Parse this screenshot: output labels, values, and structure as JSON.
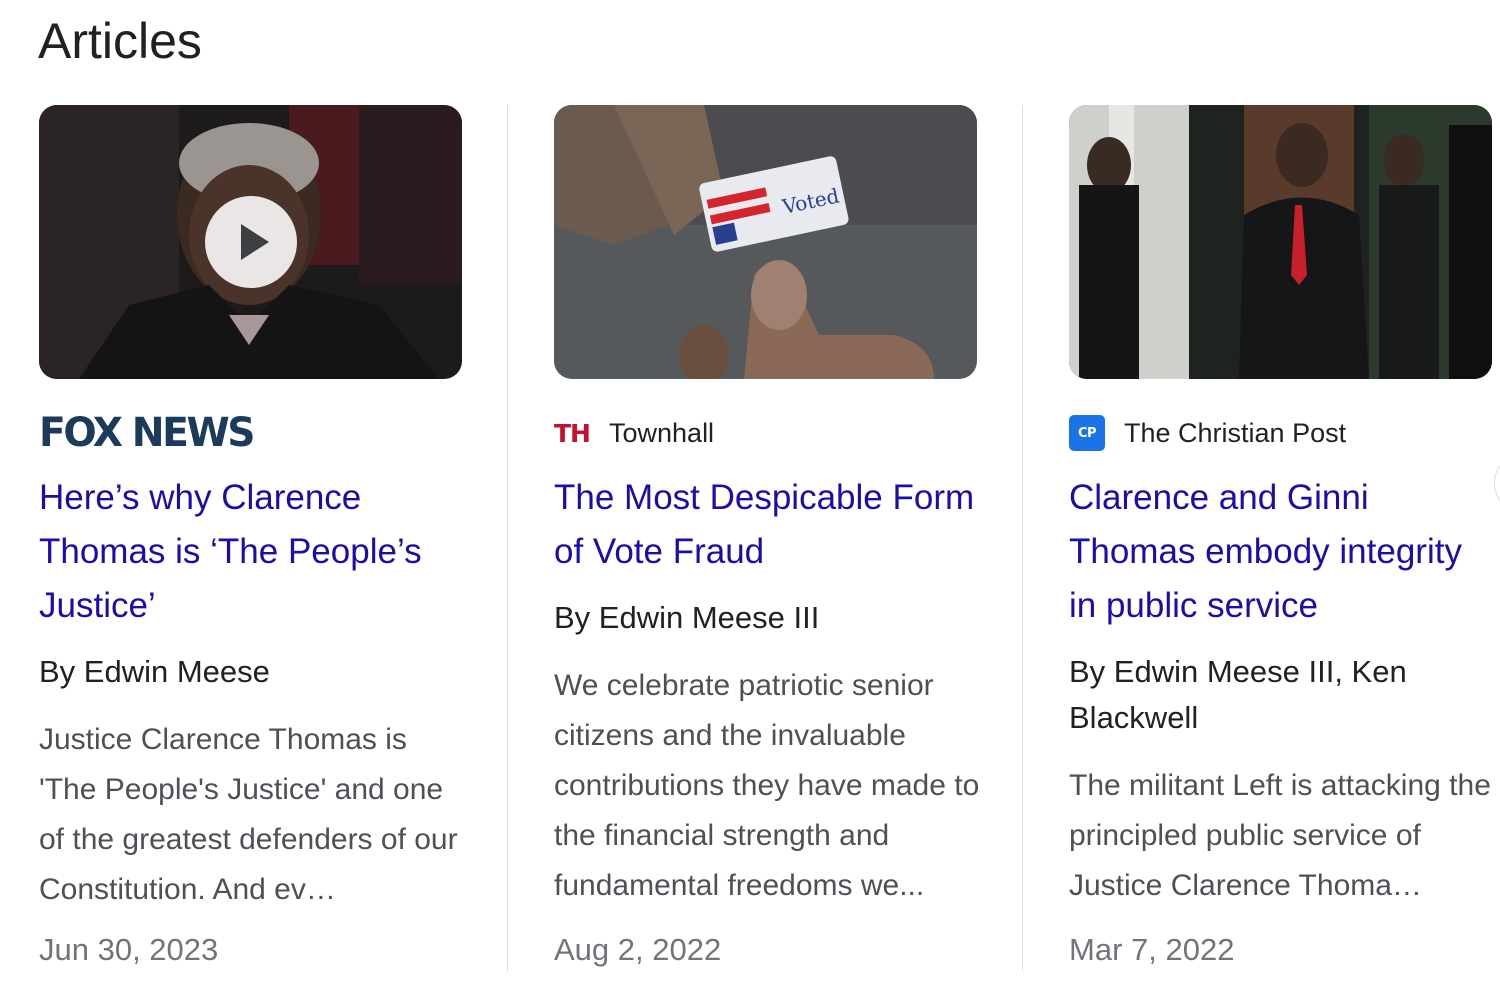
{
  "section": {
    "title": "Articles"
  },
  "articles": [
    {
      "source": "FOX NEWS",
      "source_logo": "fox-news-logo",
      "has_video": true,
      "headline": "Here’s why Clarence Thomas is ‘The People’s Justice’",
      "byline": "By Edwin Meese",
      "snippet": "Justice Clarence Thomas is 'The People's Justice' and one of the greatest defenders of our Constitution. And ev…",
      "date": "Jun 30, 2023"
    },
    {
      "source": "Townhall",
      "source_icon_text": "TH",
      "has_video": false,
      "headline": "The Most Despicable Form of Vote Fraud",
      "byline": "By Edwin Meese III",
      "snippet": "We celebrate patriotic senior citizens and the invaluable contributions they have made to the financial strength and fundamental freedoms we...",
      "date": "Aug 2, 2022"
    },
    {
      "source": "The Christian Post",
      "source_icon_text": "CP",
      "has_video": false,
      "headline": "Clarence and Ginni Thomas embody integrity in public service",
      "byline": "By Edwin Meese III, Ken Blackwell",
      "snippet": "The militant Left is attacking the principled public service of Justice Clarence Thoma…",
      "date": "Mar 7, 2022"
    }
  ],
  "colors": {
    "headline_link": "#1a0dab",
    "fox_navy": "#1b3a5c",
    "townhall_red": "#c8102e",
    "cp_blue": "#1a73e8"
  }
}
